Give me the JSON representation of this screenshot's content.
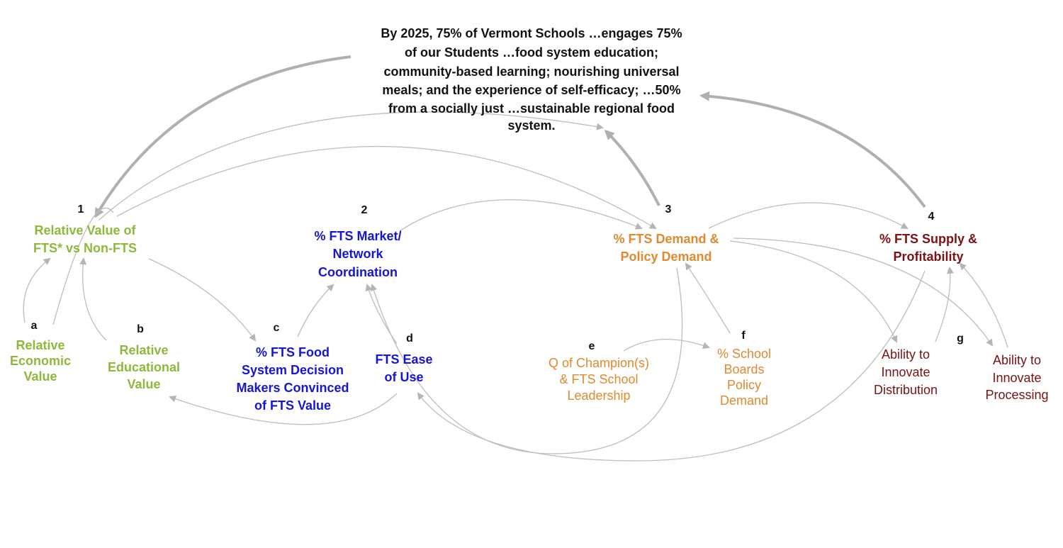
{
  "goal": {
    "lines": [
      "By 2025, 75% of Vermont Schools …engages 75%",
      "of our Students …food system education;",
      "community-based learning; nourishing universal",
      "meals; and the experience of self-efficacy; …50%",
      "from a socially just …sustainable regional food",
      "system."
    ]
  },
  "nodes": {
    "n1": {
      "num": "1",
      "lines": [
        "Relative Value of",
        "FTS* vs Non-FTS"
      ],
      "color": "#8db83a"
    },
    "n2": {
      "num": "2",
      "lines": [
        "% FTS Market/",
        "Network",
        "Coordination"
      ],
      "color": "#1515d8"
    },
    "n3": {
      "num": "3",
      "lines": [
        "% FTS Demand &",
        "Policy Demand"
      ],
      "color": "#e0892e"
    },
    "n4": {
      "num": "4",
      "lines": [
        "% FTS Supply &",
        "Profitability"
      ],
      "color": "#7a1212"
    },
    "a": {
      "num": "a",
      "lines": [
        "Relative",
        "Economic",
        "Value"
      ]
    },
    "b": {
      "num": "b",
      "lines": [
        "Relative",
        "Educational",
        "Value"
      ]
    },
    "c": {
      "num": "c",
      "lines": [
        "% FTS Food",
        "System Decision",
        "Makers Convinced",
        "of FTS Value"
      ]
    },
    "d": {
      "num": "d",
      "lines": [
        "FTS Ease",
        "of Use"
      ]
    },
    "e": {
      "num": "e",
      "lines": [
        "Q of Champion(s)",
        "& FTS School",
        "Leadership"
      ]
    },
    "f": {
      "num": "f",
      "lines": [
        "% School",
        "Boards",
        "Policy",
        "Demand"
      ]
    },
    "g": {
      "num": "g"
    },
    "dist": {
      "lines": [
        "Ability to",
        "Innovate",
        "Distribution"
      ]
    },
    "proc": {
      "lines": [
        "Ability to",
        "Innovate",
        "Processing"
      ]
    }
  },
  "arrow_color": "#b5b5b5"
}
